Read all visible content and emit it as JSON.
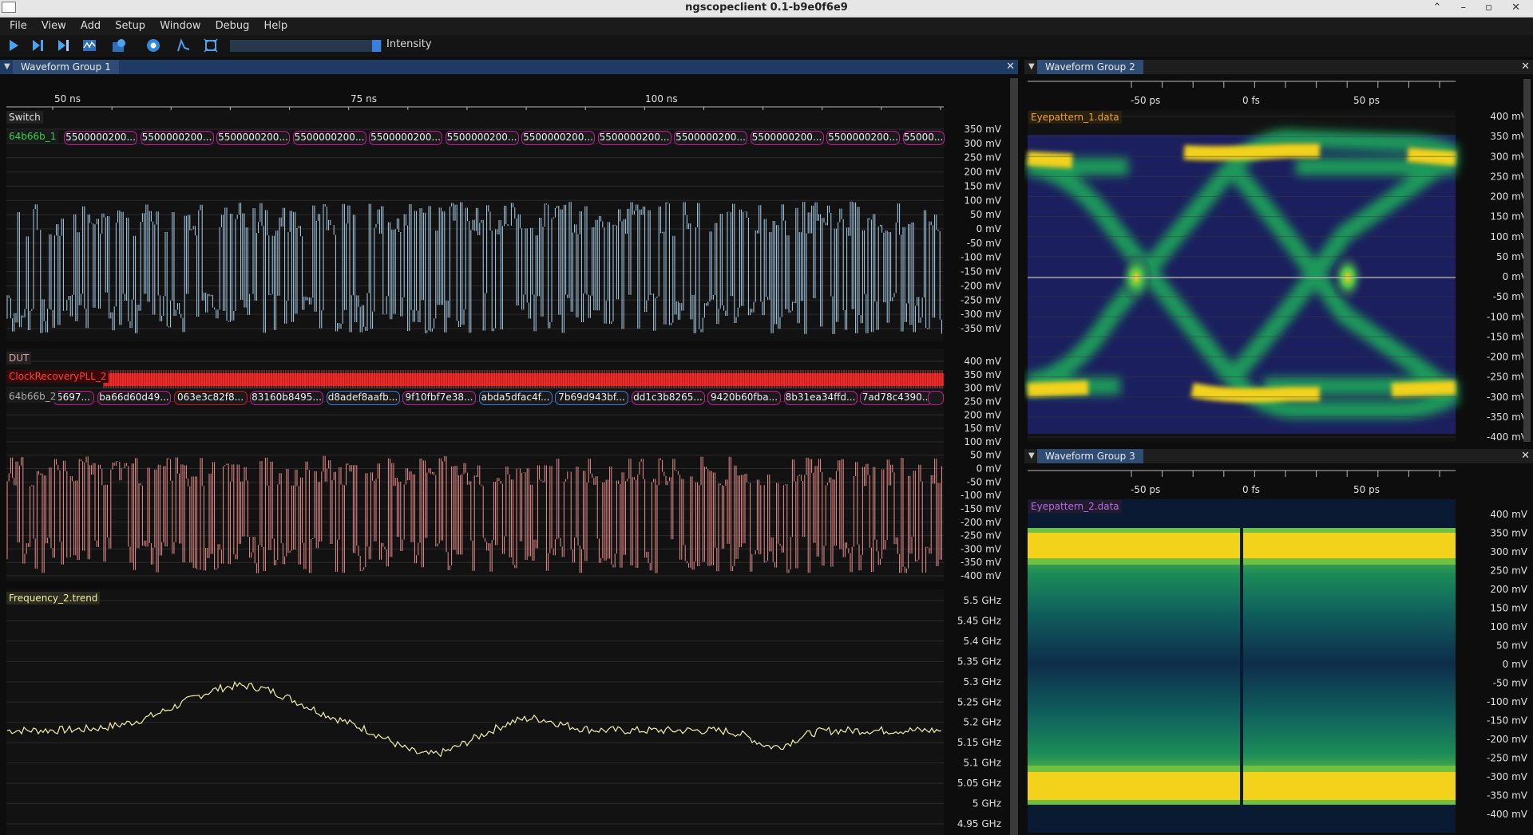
{
  "app": {
    "title": "ngscopeclient 0.1-b9e0f6e9",
    "window_buttons": "⌃ – ▫ ✕"
  },
  "menu": {
    "items": [
      "File",
      "View",
      "Add",
      "Setup",
      "Window",
      "Debug",
      "Help"
    ]
  },
  "toolbar": {
    "intensity_label": "Intensity",
    "icons": [
      "play-icon",
      "single-trigger-icon",
      "force-trigger-icon",
      "history-icon",
      "lab-notebook-icon",
      "settings-icon",
      "generate-filter-icon",
      "fullscreen-icon"
    ]
  },
  "group1": {
    "title": "Waveform Group 1",
    "close": "✕",
    "time_ticks": [
      "50 ns",
      "75 ns",
      "100 ns"
    ],
    "plot1": {
      "label": "Switch",
      "decode_label": "64b66b_1",
      "decode_text": "5500000200...",
      "decode_last": "55000...",
      "wave_color": "#a9cfe8",
      "decode_color": "#c8179b",
      "ticks": [
        "350 mV",
        "300 mV",
        "250 mV",
        "200 mV",
        "150 mV",
        "100 mV",
        "50 mV",
        "0 mV",
        "-50 mV",
        "-100 mV",
        "-150 mV",
        "-200 mV",
        "-250 mV",
        "-300 mV",
        "-350 mV"
      ]
    },
    "plot2": {
      "label": "DUT",
      "clock_label": "ClockRecoveryPLL_2",
      "decode_label": "64b66b_2",
      "decode_first": "5697...",
      "decode_items": [
        "ba66d60d49...",
        "063e3c82f8...",
        "83160b8495...",
        "d8adef8aafb...",
        "9f10fbf7e38...",
        "abda5dfac4f...",
        "7b69d943bf...",
        "dd1c3b8265...",
        "9420b60fba...",
        "8b31ea34ffd...",
        "7ad78c4390..."
      ],
      "wave_color": "#e98e8e",
      "clock_color": "#d01818",
      "ticks": [
        "400 mV",
        "350 mV",
        "300 mV",
        "250 mV",
        "200 mV",
        "150 mV",
        "100 mV",
        "50 mV",
        "0 mV",
        "-50 mV",
        "-100 mV",
        "-150 mV",
        "-200 mV",
        "-250 mV",
        "-300 mV",
        "-350 mV",
        "-400 mV"
      ]
    },
    "plot3": {
      "label": "Frequency_2.trend",
      "wave_color": "#f0f0b0",
      "ticks": [
        "5.5 GHz",
        "5.45 GHz",
        "5.4 GHz",
        "5.35 GHz",
        "5.3 GHz",
        "5.25 GHz",
        "5.2 GHz",
        "5.15 GHz",
        "5.1 GHz",
        "5.05 GHz",
        "5 GHz",
        "4.95 GHz"
      ]
    }
  },
  "group2": {
    "title": "Waveform Group 2",
    "close": "✕",
    "time_ticks": [
      "-50 ps",
      "0 fs",
      "50 ps"
    ],
    "label": "Eyepattern_1.data",
    "ticks": [
      "400 mV",
      "350 mV",
      "300 mV",
      "250 mV",
      "200 mV",
      "150 mV",
      "100 mV",
      "50 mV",
      "0 mV",
      "-50 mV",
      "-100 mV",
      "-150 mV",
      "-200 mV",
      "-250 mV",
      "-300 mV",
      "-350 mV",
      "-400 mV"
    ]
  },
  "group3": {
    "title": "Waveform Group 3",
    "close": "✕",
    "time_ticks": [
      "-50 ps",
      "0 fs",
      "50 ps"
    ],
    "label": "Eyepattern_2.data",
    "ticks": [
      "400 mV",
      "350 mV",
      "300 mV",
      "250 mV",
      "200 mV",
      "150 mV",
      "100 mV",
      "50 mV",
      "0 mV",
      "-50 mV",
      "-100 mV",
      "-150 mV",
      "-200 mV",
      "-250 mV",
      "-300 mV",
      "-350 mV",
      "-400 mV"
    ]
  },
  "colors": {
    "accent": "#2f4d74",
    "eye_hot": "#f2d21a",
    "eye_mid": "#1f9a5a",
    "eye_cold": "#1b1f5e"
  }
}
